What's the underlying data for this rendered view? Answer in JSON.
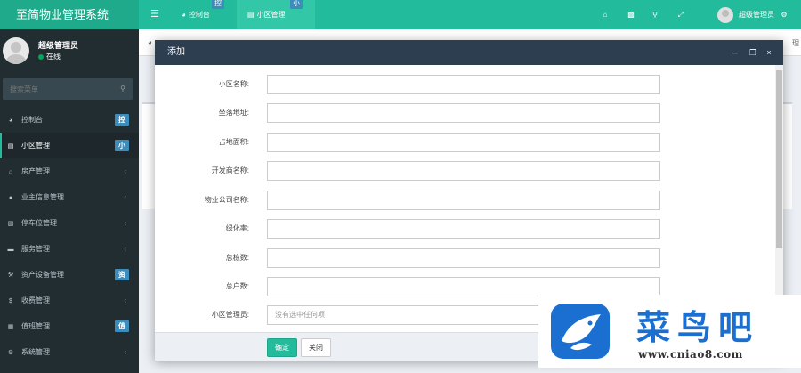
{
  "app": {
    "title": "至简物业管理系统"
  },
  "topbar": {
    "tabs": [
      {
        "label": "控制台",
        "badge": "控"
      },
      {
        "label": "小区管理",
        "badge": "小"
      }
    ],
    "user_name": "超级管理员"
  },
  "sidebar": {
    "user": {
      "name": "超级管理员",
      "status": "在线"
    },
    "search_placeholder": "搜索菜单",
    "items": [
      {
        "label": "控制台",
        "badge": "控",
        "icon": "dashboard-icon"
      },
      {
        "label": "小区管理",
        "badge": "小",
        "icon": "list-icon"
      },
      {
        "label": "房产管理",
        "icon": "home-icon"
      },
      {
        "label": "业主信息管理",
        "icon": "user-icon"
      },
      {
        "label": "停车位管理",
        "icon": "parking-icon"
      },
      {
        "label": "服务管理",
        "icon": "service-icon"
      },
      {
        "label": "资产设备管理",
        "badge": "资",
        "icon": "wrench-icon"
      },
      {
        "label": "收费管理",
        "icon": "dollar-icon"
      },
      {
        "label": "值班管理",
        "badge": "值",
        "icon": "calendar-icon"
      },
      {
        "label": "系统管理",
        "icon": "cogs-icon"
      }
    ]
  },
  "content": {
    "strip_right": "理"
  },
  "modal": {
    "title": "添加",
    "fields": [
      {
        "label": "小区名称:",
        "value": ""
      },
      {
        "label": "坐落地址:",
        "value": ""
      },
      {
        "label": "占地面积:",
        "value": ""
      },
      {
        "label": "开发商名称:",
        "value": ""
      },
      {
        "label": "物业公司名称:",
        "value": ""
      },
      {
        "label": "绿化率:",
        "value": ""
      },
      {
        "label": "总栋数:",
        "value": ""
      },
      {
        "label": "总户数:",
        "value": ""
      },
      {
        "label": "小区管理员:",
        "value": "没有选中任何项"
      }
    ],
    "ok_label": "确定",
    "close_label": "关闭"
  },
  "watermark": {
    "text": "菜鸟吧",
    "url": "www.cniao8.com"
  },
  "colors": {
    "header": "#22bc9c",
    "sidebar": "#222d32",
    "badge": "#3c8dbc",
    "modal_header": "#2c3e50"
  }
}
